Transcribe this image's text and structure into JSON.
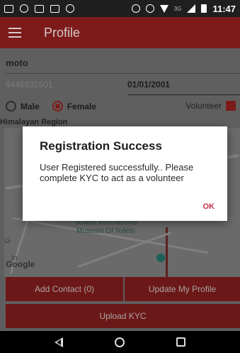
{
  "status_bar": {
    "network_label": "3G",
    "time": "11:47"
  },
  "app_bar": {
    "title": "Profile"
  },
  "form": {
    "name_value": "moto",
    "phone_value": "9446535501",
    "dob_value": "01/01/2001",
    "gender": {
      "male_label": "Male",
      "female_label": "Female",
      "selected": "Female"
    },
    "volunteer_label": "Volunteer",
    "volunteer_checked": true,
    "location_label": "Himalayan Region"
  },
  "map": {
    "place_label_line1": "Sulabh International",
    "place_label_line2": "Museum Of Toilets",
    "google_logo": "Google",
    "edge_letter_1": "G",
    "edge_letter_2": "In"
  },
  "buttons": {
    "add_contact": "Add Contact (0)",
    "update_profile": "Update My Profile",
    "upload_kyc": "Upload KYC"
  },
  "dialog": {
    "title": "Registration Success",
    "message": "User Registered successfully.. Please complete KYC to act as a volunteer",
    "ok_label": "OK"
  },
  "colors": {
    "brand": "#7d1b1b",
    "accent_ok": "#c3314a"
  }
}
